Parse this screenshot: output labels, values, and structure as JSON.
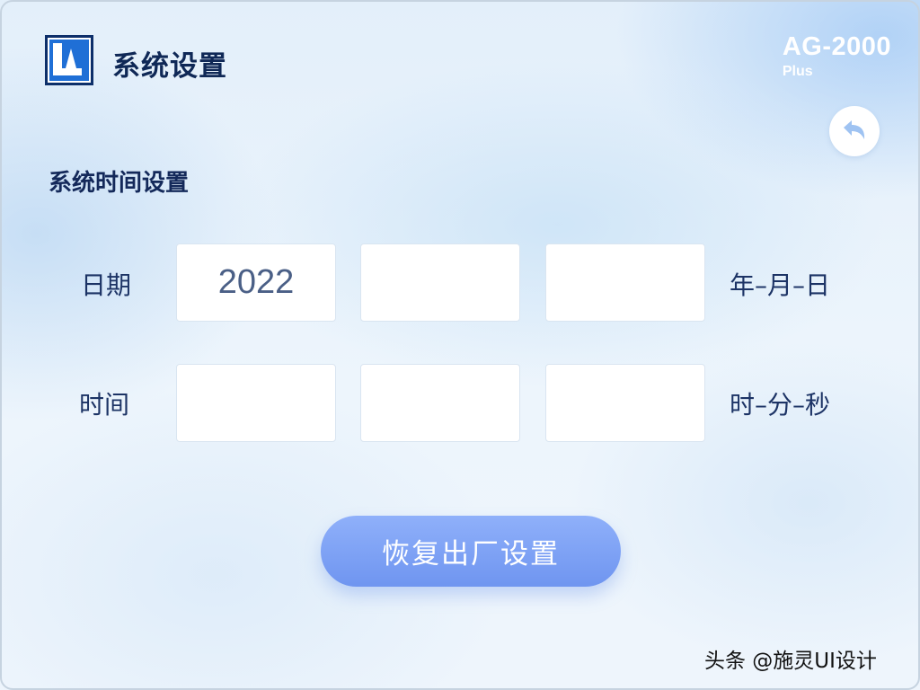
{
  "header": {
    "app_title": "系统设置",
    "model_name": "AG-2000",
    "model_sub": "Plus",
    "back_icon": "back-arrow-icon",
    "logo_icon": "app-logo-icon"
  },
  "section": {
    "title": "系统时间设置"
  },
  "date_row": {
    "label": "日期",
    "year_value": "2022",
    "month_value": "",
    "day_value": "",
    "unit": "年–月–日"
  },
  "time_row": {
    "label": "时间",
    "hour_value": "",
    "minute_value": "",
    "second_value": "",
    "unit": "时–分–秒"
  },
  "actions": {
    "reset_label": "恢复出厂设置"
  },
  "watermark": "头条 @施灵UI设计",
  "colors": {
    "accent": "#7a9ef4",
    "title_text": "#0f2856",
    "logo_blue": "#1f6fd6"
  }
}
